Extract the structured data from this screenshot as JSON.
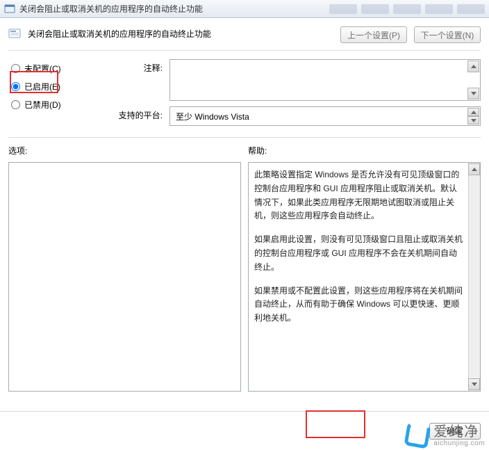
{
  "window": {
    "title": "关闭会阻止或取消关机的应用程序的自动终止功能"
  },
  "header": {
    "title": "关闭会阻止或取消关机的应用程序的自动终止功能",
    "prev_label": "上一个设置(P)",
    "next_label": "下一个设置(N)"
  },
  "radios": {
    "not_configured": "未配置(C)",
    "enabled": "已启用(E)",
    "disabled": "已禁用(D)",
    "selected": "enabled"
  },
  "comment": {
    "label": "注释:",
    "value": ""
  },
  "supported": {
    "label": "支持的平台:",
    "value": "至少 Windows Vista"
  },
  "sections": {
    "options_label": "选项:",
    "help_label": "帮助:"
  },
  "help": {
    "p1": "此策略设置指定 Windows 是否允许没有可见顶级窗口的控制台应用程序和 GUI 应用程序阻止或取消关机。默认情况下，如果此类应用程序无限期地试图取消或阻止关机，则这些应用程序会自动终止。",
    "p2": "如果启用此设置，则没有可见顶级窗口且阻止或取消关机的控制台应用程序或 GUI 应用程序不会在关机期间自动终止。",
    "p3": "如果禁用或不配置此设置，则这些应用程序将在关机期间自动终止，从而有助于确保 Windows 可以更快速、更顺利地关机。"
  },
  "footer": {
    "ok_label": "确定"
  },
  "watermark": {
    "cn": "爱纯净",
    "en": "aichunjing.com"
  }
}
